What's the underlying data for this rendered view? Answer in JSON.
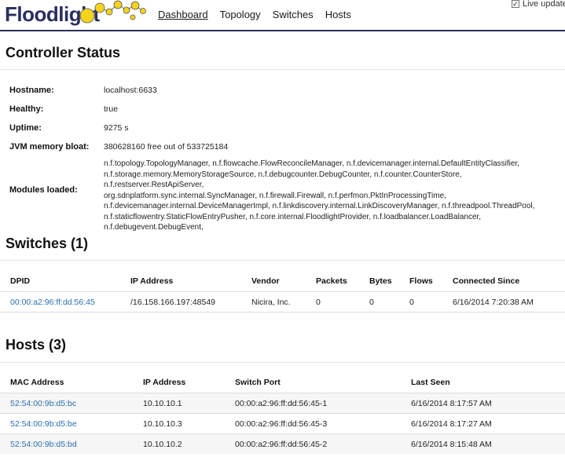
{
  "app": {
    "logo_text": "Floodlight",
    "nav": [
      "Dashboard",
      "Topology",
      "Switches",
      "Hosts"
    ],
    "live_updates_label": "Live updates",
    "live_updates_checked": true
  },
  "controller": {
    "title": "Controller Status",
    "hostname_label": "Hostname:",
    "hostname": "localhost:6633",
    "healthy_label": "Healthy:",
    "healthy": "true",
    "uptime_label": "Uptime:",
    "uptime": "9275 s",
    "jvm_label": "JVM memory bloat:",
    "jvm": "380628160 free out of 533725184",
    "modules_label": "Modules loaded:",
    "modules_lines": [
      "n.f.topology.TopologyManager, n.f.flowcache.FlowReconcileManager, n.f.devicemanager.internal.DefaultEntityClassifier,",
      "n.f.storage.memory.MemoryStorageSource, n.f.debugcounter.DebugCounter, n.f.counter.CounterStore, n.f.restserver.RestApiServer,",
      "org.sdnplatform.sync.internal.SyncManager, n.f.firewall.Firewall, n.f.perfmon.PktInProcessingTime,",
      "n.f.devicemanager.internal.DeviceManagerImpl, n.f.linkdiscovery.internal.LinkDiscoveryManager, n.f.threadpool.ThreadPool,",
      "n.f.staticflowentry.StaticFlowEntryPusher, n.f.core.internal.FloodlightProvider, n.f.loadbalancer.LoadBalancer,",
      "n.f.debugevent.DebugEvent,"
    ]
  },
  "switches": {
    "title": "Switches (1)",
    "headers": [
      "DPID",
      "IP Address",
      "Vendor",
      "Packets",
      "Bytes",
      "Flows",
      "Connected Since"
    ],
    "rows": [
      [
        "00:00:a2:96:ff:dd:56:45",
        "/16.158.166.197:48549",
        "Nicira, Inc.",
        "0",
        "0",
        "0",
        "6/16/2014 7:20:38 AM"
      ]
    ]
  },
  "hosts": {
    "title": "Hosts (3)",
    "headers": [
      "MAC Address",
      "IP Address",
      "Switch Port",
      "Last Seen"
    ],
    "rows": [
      [
        "52:54:00:9b:d5:bc",
        "10.10.10.1",
        "00:00:a2:96:ff:dd:56:45-1",
        "6/16/2014 8:17:57 AM"
      ],
      [
        "52:54:00:9b:d5:be",
        "10.10.10.3",
        "00:00:a2:96:ff:dd:56:45-3",
        "6/16/2014 8:17:27 AM"
      ],
      [
        "52:54:00:9b:d5:bd",
        "10.10.10.2",
        "00:00:a2:96:ff:dd:56:45-2",
        "6/16/2014 8:15:48 AM"
      ]
    ]
  },
  "colors": {
    "brand": "#2b2f5e",
    "link": "#2a6fb0",
    "logo_bubble": "#f5d31c"
  }
}
